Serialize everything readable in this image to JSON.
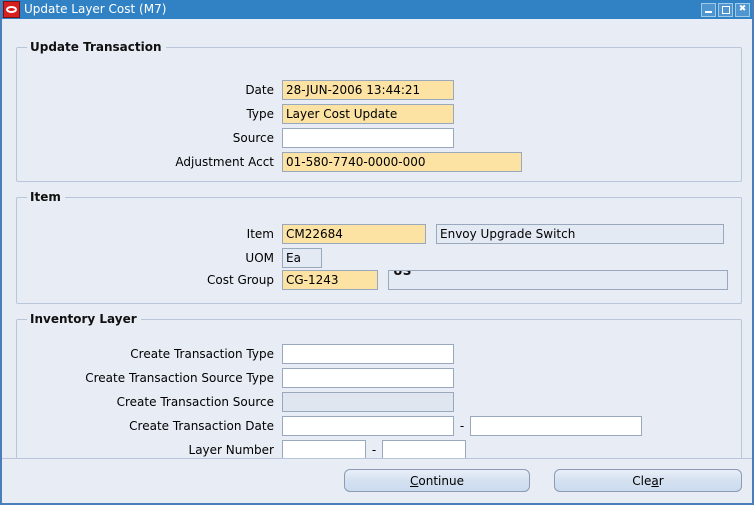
{
  "window": {
    "title": "Update Layer Cost (M7)",
    "icon": "oracle-logo-icon",
    "controls": {
      "minimize": "minimize-button",
      "maximize": "maximize-button",
      "close_label": "✖"
    },
    "colors": {
      "titlebar": "#3182c4",
      "body": "#e8edf5",
      "required_field": "#fce3a4",
      "readonly_field": "#e4eaf3",
      "group_border": "#b9c6da",
      "icon_red": "#d61f1f"
    }
  },
  "sections": {
    "update_transaction": {
      "title": "Update Transaction",
      "fields": {
        "date": {
          "label": "Date",
          "value": "28-JUN-2006 13:44:21"
        },
        "type": {
          "label": "Type",
          "value": "Layer Cost Update"
        },
        "source": {
          "label": "Source",
          "value": "",
          "placeholder": ""
        },
        "adjustment_acct": {
          "label": "Adjustment Acct",
          "value": "01-580-7740-0000-000"
        }
      }
    },
    "item": {
      "title": "Item",
      "fields": {
        "item": {
          "label": "Item",
          "value": "CM22684"
        },
        "item_description": {
          "value": "Envoy Upgrade Switch"
        },
        "uom": {
          "label": "UOM",
          "value": "Ea"
        },
        "cost_group": {
          "label": "Cost Group",
          "value": "CG-1243"
        },
        "cost_group_description": {
          "value": "US"
        }
      }
    },
    "inventory_layer": {
      "title": "Inventory Layer",
      "fields": {
        "create_transaction_type": {
          "label": "Create Transaction Type",
          "value": ""
        },
        "create_transaction_source_type": {
          "label": "Create Transaction Source Type",
          "value": ""
        },
        "create_transaction_source": {
          "label": "Create Transaction Source",
          "value": ""
        },
        "create_transaction_date": {
          "label": "Create Transaction Date",
          "from": "",
          "to": "",
          "separator": "-"
        },
        "layer_number": {
          "label": "Layer Number",
          "from": "",
          "to": "",
          "separator": "-"
        }
      }
    }
  },
  "buttons": {
    "continue": {
      "mnemonic": "C",
      "rest": "ontinue"
    },
    "clear": {
      "pre": "Cle",
      "mnemonic": "a",
      "post": "r"
    }
  }
}
